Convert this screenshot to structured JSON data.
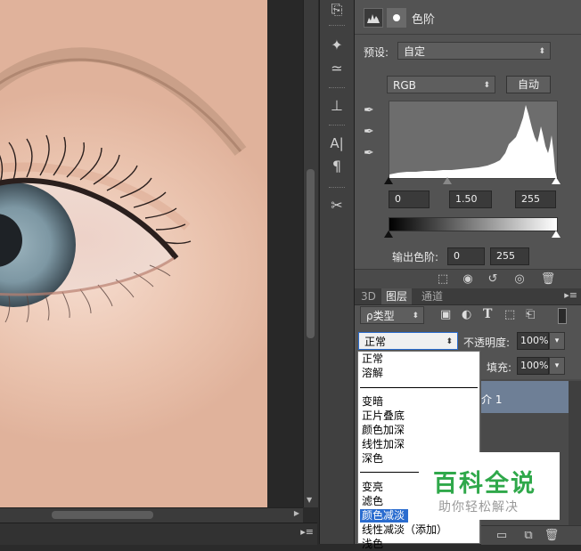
{
  "properties": {
    "title": "色阶",
    "preset_label": "预设:",
    "preset_value": "自定",
    "channel_value": "RGB",
    "auto_button": "自动",
    "input_black": "0",
    "input_gamma": "1.50",
    "input_white": "255",
    "output_label": "输出色阶:",
    "output_black": "0",
    "output_white": "255"
  },
  "layers_panel": {
    "tabs": [
      "3D",
      "图层",
      "通道"
    ],
    "filter_label": "ρ类型",
    "blend_mode_value": "正常",
    "opacity_label": "不透明度:",
    "opacity_value": "100%",
    "fill_label": "填充:",
    "fill_value": "100%",
    "layer_name_fragment": "介 1"
  },
  "blend_mode_options": {
    "group1": [
      "正常",
      "溶解"
    ],
    "group2": [
      "变暗",
      "正片叠底",
      "颜色加深",
      "线性加深",
      "深色"
    ],
    "group3": [
      "变亮",
      "滤色",
      "颜色减淡",
      "线性减淡（添加）",
      "浅色"
    ],
    "selected": "颜色减淡"
  },
  "watermark": {
    "title": "百科全说",
    "subtitle": "助你轻松解决"
  },
  "tool_strip_text": {
    "type_tool": "A|",
    "paragraph": "¶"
  },
  "colors": {
    "panel_bg": "#535353",
    "selection_blue": "#2a6ccf",
    "watermark_green": "#2fa84a",
    "layer_highlight": "#6e7f96"
  }
}
